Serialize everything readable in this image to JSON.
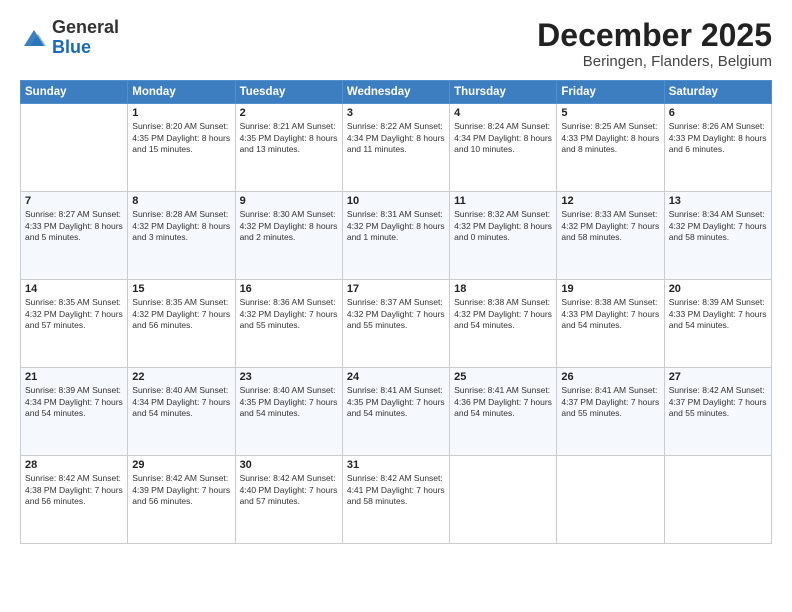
{
  "header": {
    "logo_general": "General",
    "logo_blue": "Blue",
    "month_title": "December 2025",
    "location": "Beringen, Flanders, Belgium"
  },
  "weekdays": [
    "Sunday",
    "Monday",
    "Tuesday",
    "Wednesday",
    "Thursday",
    "Friday",
    "Saturday"
  ],
  "weeks": [
    [
      {
        "day": "",
        "info": ""
      },
      {
        "day": "1",
        "info": "Sunrise: 8:20 AM\nSunset: 4:35 PM\nDaylight: 8 hours\nand 15 minutes."
      },
      {
        "day": "2",
        "info": "Sunrise: 8:21 AM\nSunset: 4:35 PM\nDaylight: 8 hours\nand 13 minutes."
      },
      {
        "day": "3",
        "info": "Sunrise: 8:22 AM\nSunset: 4:34 PM\nDaylight: 8 hours\nand 11 minutes."
      },
      {
        "day": "4",
        "info": "Sunrise: 8:24 AM\nSunset: 4:34 PM\nDaylight: 8 hours\nand 10 minutes."
      },
      {
        "day": "5",
        "info": "Sunrise: 8:25 AM\nSunset: 4:33 PM\nDaylight: 8 hours\nand 8 minutes."
      },
      {
        "day": "6",
        "info": "Sunrise: 8:26 AM\nSunset: 4:33 PM\nDaylight: 8 hours\nand 6 minutes."
      }
    ],
    [
      {
        "day": "7",
        "info": "Sunrise: 8:27 AM\nSunset: 4:33 PM\nDaylight: 8 hours\nand 5 minutes."
      },
      {
        "day": "8",
        "info": "Sunrise: 8:28 AM\nSunset: 4:32 PM\nDaylight: 8 hours\nand 3 minutes."
      },
      {
        "day": "9",
        "info": "Sunrise: 8:30 AM\nSunset: 4:32 PM\nDaylight: 8 hours\nand 2 minutes."
      },
      {
        "day": "10",
        "info": "Sunrise: 8:31 AM\nSunset: 4:32 PM\nDaylight: 8 hours\nand 1 minute."
      },
      {
        "day": "11",
        "info": "Sunrise: 8:32 AM\nSunset: 4:32 PM\nDaylight: 8 hours\nand 0 minutes."
      },
      {
        "day": "12",
        "info": "Sunrise: 8:33 AM\nSunset: 4:32 PM\nDaylight: 7 hours\nand 58 minutes."
      },
      {
        "day": "13",
        "info": "Sunrise: 8:34 AM\nSunset: 4:32 PM\nDaylight: 7 hours\nand 58 minutes."
      }
    ],
    [
      {
        "day": "14",
        "info": "Sunrise: 8:35 AM\nSunset: 4:32 PM\nDaylight: 7 hours\nand 57 minutes."
      },
      {
        "day": "15",
        "info": "Sunrise: 8:35 AM\nSunset: 4:32 PM\nDaylight: 7 hours\nand 56 minutes."
      },
      {
        "day": "16",
        "info": "Sunrise: 8:36 AM\nSunset: 4:32 PM\nDaylight: 7 hours\nand 55 minutes."
      },
      {
        "day": "17",
        "info": "Sunrise: 8:37 AM\nSunset: 4:32 PM\nDaylight: 7 hours\nand 55 minutes."
      },
      {
        "day": "18",
        "info": "Sunrise: 8:38 AM\nSunset: 4:32 PM\nDaylight: 7 hours\nand 54 minutes."
      },
      {
        "day": "19",
        "info": "Sunrise: 8:38 AM\nSunset: 4:33 PM\nDaylight: 7 hours\nand 54 minutes."
      },
      {
        "day": "20",
        "info": "Sunrise: 8:39 AM\nSunset: 4:33 PM\nDaylight: 7 hours\nand 54 minutes."
      }
    ],
    [
      {
        "day": "21",
        "info": "Sunrise: 8:39 AM\nSunset: 4:34 PM\nDaylight: 7 hours\nand 54 minutes."
      },
      {
        "day": "22",
        "info": "Sunrise: 8:40 AM\nSunset: 4:34 PM\nDaylight: 7 hours\nand 54 minutes."
      },
      {
        "day": "23",
        "info": "Sunrise: 8:40 AM\nSunset: 4:35 PM\nDaylight: 7 hours\nand 54 minutes."
      },
      {
        "day": "24",
        "info": "Sunrise: 8:41 AM\nSunset: 4:35 PM\nDaylight: 7 hours\nand 54 minutes."
      },
      {
        "day": "25",
        "info": "Sunrise: 8:41 AM\nSunset: 4:36 PM\nDaylight: 7 hours\nand 54 minutes."
      },
      {
        "day": "26",
        "info": "Sunrise: 8:41 AM\nSunset: 4:37 PM\nDaylight: 7 hours\nand 55 minutes."
      },
      {
        "day": "27",
        "info": "Sunrise: 8:42 AM\nSunset: 4:37 PM\nDaylight: 7 hours\nand 55 minutes."
      }
    ],
    [
      {
        "day": "28",
        "info": "Sunrise: 8:42 AM\nSunset: 4:38 PM\nDaylight: 7 hours\nand 56 minutes."
      },
      {
        "day": "29",
        "info": "Sunrise: 8:42 AM\nSunset: 4:39 PM\nDaylight: 7 hours\nand 56 minutes."
      },
      {
        "day": "30",
        "info": "Sunrise: 8:42 AM\nSunset: 4:40 PM\nDaylight: 7 hours\nand 57 minutes."
      },
      {
        "day": "31",
        "info": "Sunrise: 8:42 AM\nSunset: 4:41 PM\nDaylight: 7 hours\nand 58 minutes."
      },
      {
        "day": "",
        "info": ""
      },
      {
        "day": "",
        "info": ""
      },
      {
        "day": "",
        "info": ""
      }
    ]
  ]
}
